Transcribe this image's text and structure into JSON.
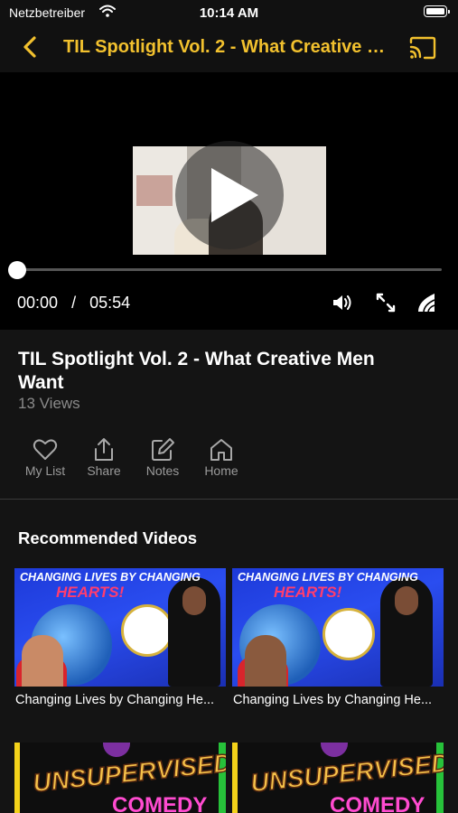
{
  "status_bar": {
    "carrier": "Netzbetreiber",
    "time": "10:14 AM",
    "icons": [
      "wifi-icon",
      "battery-icon"
    ]
  },
  "nav": {
    "title": "TIL Spotlight Vol. 2 - What Creative Men Want",
    "accent_color": "#f2c12e",
    "icons": [
      "back-chevron-icon",
      "cast-icon"
    ]
  },
  "player": {
    "current_time": "00:00",
    "separator": "/",
    "duration": "05:54",
    "progress_fraction": 0,
    "controls": [
      "play-icon",
      "volume-icon",
      "fullscreen-icon",
      "quality-icon"
    ]
  },
  "video": {
    "title": "TIL Spotlight Vol. 2 - What Creative Men Want",
    "views": "13 Views"
  },
  "actions": [
    {
      "label": "My List",
      "icon": "heart-icon"
    },
    {
      "label": "Share",
      "icon": "share-icon"
    },
    {
      "label": "Notes",
      "icon": "edit-icon"
    },
    {
      "label": "Home",
      "icon": "home-icon"
    }
  ],
  "recommended": {
    "heading": "Recommended Videos",
    "items": [
      {
        "caption": "Changing Lives by Changing He...",
        "thumb_line1": "CHANGING LIVES BY CHANGING",
        "thumb_line2": "HEARTS!"
      },
      {
        "caption": "Changing Lives by Changing He...",
        "thumb_line1": "CHANGING LIVES BY CHANGING",
        "thumb_line2": "HEARTS!"
      },
      {
        "caption": "",
        "thumb_line1": "UNSUPERVISED",
        "thumb_line2": "COMEDY"
      },
      {
        "caption": "",
        "thumb_line1": "UNSUPERVISED",
        "thumb_line2": "COMEDY"
      }
    ]
  }
}
